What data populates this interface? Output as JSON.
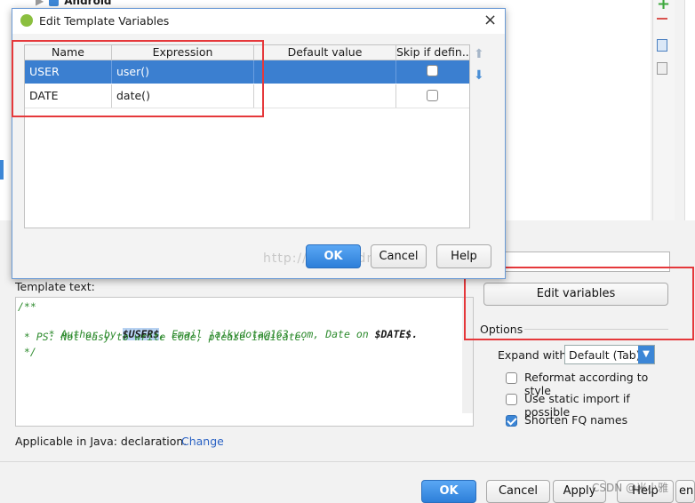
{
  "background": {
    "tree_item": "Android",
    "template_text_label": "Template text:",
    "template_lines": [
      "/**",
      " * Author by ",
      "$USER$",
      ", Email jaikydota@163.com, Date on ",
      "$DATE$.",
      " * PS: Not easy to write code, please indicate.",
      " */"
    ],
    "applicable_label": "Applicable in Java: declaration.",
    "change_link": "Change",
    "edit_variables_button": "Edit variables",
    "options_label": "Options",
    "expand_with_label": "Expand with",
    "expand_with_value": "Default (Tab)",
    "options": [
      {
        "label": "Reformat according to style",
        "checked": false
      },
      {
        "label": "Use static import if possible",
        "checked": false
      },
      {
        "label": "Shorten FQ names",
        "checked": true
      }
    ],
    "footer_buttons": {
      "ok": "OK",
      "cancel": "Cancel",
      "apply": "Apply",
      "help": "Help",
      "partial": "en"
    },
    "watermark_csdn": "CSDN @米小雅",
    "toolbar_icons": [
      "plus-icon",
      "minus-icon",
      "copy-icon",
      "settings-icon"
    ]
  },
  "dialog": {
    "title": "Edit Template Variables",
    "close_symbol": "×",
    "columns": [
      "Name",
      "Expression",
      "Default value",
      "Skip if defin..."
    ],
    "rows": [
      {
        "name": "USER",
        "expression": "user()",
        "default_value": "",
        "skip": false,
        "selected": true
      },
      {
        "name": "DATE",
        "expression": "date()",
        "default_value": "",
        "skip": false,
        "selected": false
      }
    ],
    "buttons": {
      "ok": "OK",
      "cancel": "Cancel",
      "help": "Help"
    },
    "watermark": "http://blog.csdn.net/"
  },
  "colors": {
    "accent": "#3c86d6",
    "selection": "#3b7fd0",
    "highlight_box": "#e5383b",
    "link": "#2a62c4"
  }
}
